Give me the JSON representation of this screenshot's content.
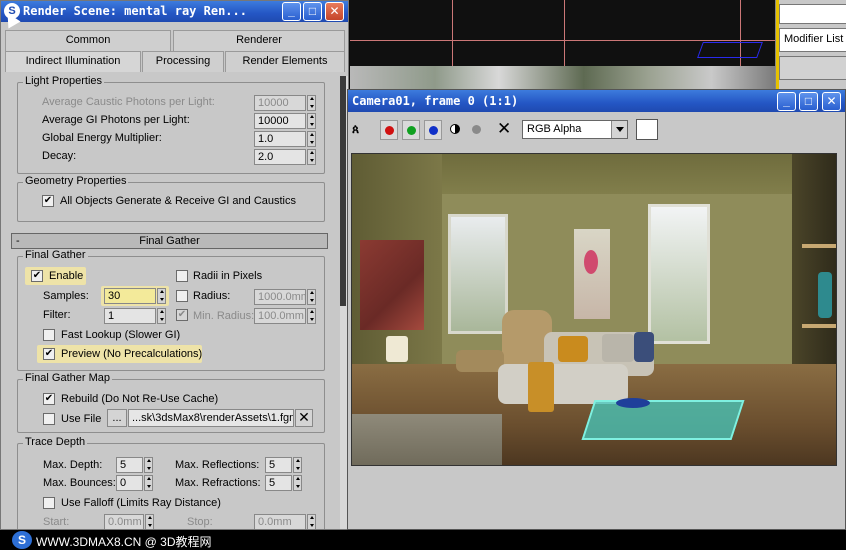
{
  "dialog": {
    "title": "Render Scene: mental ray Ren...",
    "tabs_row1": [
      "Common",
      "Renderer"
    ],
    "tabs_row2": [
      "Indirect Illumination",
      "Processing",
      "Render Elements"
    ],
    "light_properties": {
      "label": "Light Properties",
      "avg_caustic_label": "Average Caustic Photons per Light:",
      "avg_caustic_value": "10000",
      "avg_gi_label": "Average GI Photons per Light:",
      "avg_gi_value": "10000",
      "energy_label": "Global Energy Multiplier:",
      "energy_value": "1.0",
      "decay_label": "Decay:",
      "decay_value": "2.0"
    },
    "geometry_properties": {
      "label": "Geometry Properties",
      "all_objects_label": "All Objects Generate & Receive GI and Caustics",
      "all_objects_checked": "✔"
    },
    "final_gather_rollout": {
      "minus": "-",
      "title": "Final Gather"
    },
    "final_gather": {
      "label": "Final Gather",
      "enable_label": "Enable",
      "enable_checked": "✔",
      "radii_label": "Radii in Pixels",
      "samples_label": "Samples:",
      "samples_value": "30",
      "radius_label": "Radius:",
      "radius_value": "1000.0mm",
      "filter_label": "Filter:",
      "filter_value": "1",
      "min_radius_label": "Min. Radius:",
      "min_radius_value": "100.0mm",
      "min_radius_checked": "✔",
      "fast_lookup_label": "Fast Lookup (Slower GI)",
      "preview_label": "Preview (No Precalculations)",
      "preview_checked": "✔"
    },
    "final_gather_map": {
      "label": "Final Gather Map",
      "rebuild_label": "Rebuild (Do Not Re-Use Cache)",
      "rebuild_checked": "✔",
      "use_file_label": "Use File",
      "browse_label": "...",
      "file_path": "...sk\\3dsMax8\\renderAssets\\1.fgm",
      "clear_label": "✕"
    },
    "trace_depth": {
      "label": "Trace Depth",
      "max_depth_label": "Max. Depth:",
      "max_depth_value": "5",
      "max_reflections_label": "Max. Reflections:",
      "max_reflections_value": "5",
      "max_bounces_label": "Max. Bounces:",
      "max_bounces_value": "0",
      "max_refractions_label": "Max. Refractions:",
      "max_refractions_value": "5",
      "use_falloff_label": "Use Falloff (Limits Ray Distance)",
      "start_label": "Start:",
      "start_value": "0.0mm",
      "stop_label": "Stop:",
      "stop_value": "0.0mm"
    }
  },
  "camera_window": {
    "title": "Camera01, frame 0 (1:1)",
    "channel_select": "RGB Alpha",
    "channel_colors": {
      "red": "#d01010",
      "green": "#10a020",
      "blue": "#1030c8"
    }
  },
  "right_panel": {
    "modifier_list": "Modifier List"
  },
  "watermark": {
    "logo": "S",
    "text": "WWW.3DMAX8.CN @ 3D教程网"
  },
  "colors": {
    "title_blue": "#2456c4",
    "highlight": "#eee3a8",
    "panel_gray": "#c8c8c8"
  }
}
